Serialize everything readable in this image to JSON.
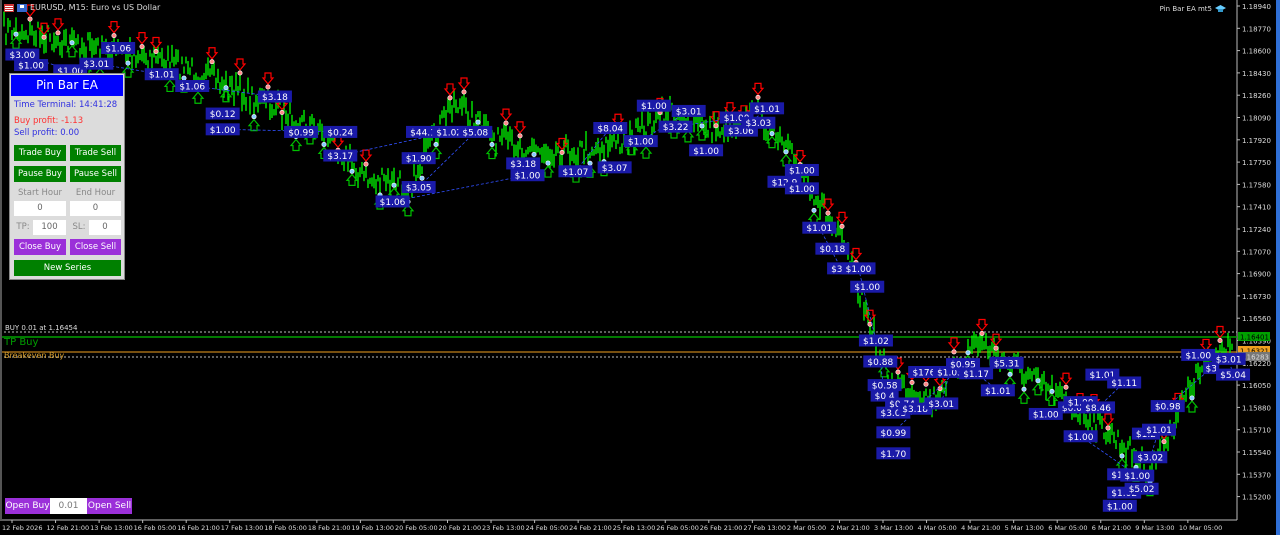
{
  "header": {
    "symbol_title": "EURUSD, M15:  Euro vs US Dollar",
    "ea_label": "Pin Bar EA mt5",
    "icons": [
      "menu-icon",
      "chart-type-icon",
      "hat-icon"
    ]
  },
  "panel": {
    "title": "Pin Bar EA",
    "time_terminal": "Time Terminal: 14:41:28",
    "buy_profit": "Buy profit: -1.13",
    "sell_profit": "Sell profit: 0.00",
    "trade_buy": "Trade Buy",
    "trade_sell": "Trade Sell",
    "pause_buy": "Pause Buy",
    "pause_sell": "Pause Sell",
    "start_hour_label": "Start Hour",
    "end_hour_label": "End Hour",
    "start_hour": "0",
    "end_hour": "0",
    "tp_label": "TP:",
    "tp_value": "100",
    "sl_label": "SL:",
    "sl_value": "0",
    "close_buy": "Close Buy",
    "close_sell": "Close Sell",
    "new_series": "New Series"
  },
  "bottom_bar": {
    "open_buy": "Open Buy",
    "lot": "0.01",
    "open_sell": "Open Sell"
  },
  "lines": {
    "buy_line_label": "BUY 0.01 at 1.16454",
    "tp_label": "TP Buy",
    "breakeven_label": "Breakeven Buy",
    "tp_price": "1.16401",
    "bid_price": "1.16321",
    "ask_price": "1.16283"
  },
  "colors": {
    "bull": "#00ff00",
    "bear_arrow": "#ff0000",
    "bull_arrow": "#00c000",
    "label_bg": "#1a1aa8",
    "tp": "#00a000",
    "bid": "#f0a020",
    "panel_title": "#0000ff"
  },
  "chart_data": {
    "type": "candlestick",
    "symbol": "EURUSD",
    "timeframe": "M15",
    "y_ticks": [
      "1.18940",
      "1.18770",
      "1.18600",
      "1.18430",
      "1.18260",
      "1.18090",
      "1.17920",
      "1.17750",
      "1.17580",
      "1.17410",
      "1.17240",
      "1.17070",
      "1.16900",
      "1.16730",
      "1.16560",
      "1.16390",
      "1.16220",
      "1.16050",
      "1.15880",
      "1.15710",
      "1.15540",
      "1.15370",
      "1.15200"
    ],
    "ylim": [
      1.151,
      1.1897
    ],
    "x_ticks": [
      "12 Feb 2026",
      "12 Feb 21:00",
      "13 Feb 13:00",
      "16 Feb 05:00",
      "16 Feb 21:00",
      "17 Feb 13:00",
      "18 Feb 05:00",
      "18 Feb 21:00",
      "19 Feb 13:00",
      "20 Feb 05:00",
      "20 Feb 21:00",
      "23 Feb 13:00",
      "24 Feb 05:00",
      "24 Feb 21:00",
      "25 Feb 13:00",
      "26 Feb 05:00",
      "26 Feb 21:00",
      "27 Feb 13:00",
      "2 Mar 05:00",
      "2 Mar 21:00",
      "3 Mar 13:00",
      "4 Mar 05:00",
      "4 Mar 21:00",
      "5 Mar 13:00",
      "6 Mar 05:00",
      "6 Mar 21:00",
      "9 Mar 13:00",
      "10 Mar 05:00"
    ],
    "price_at_ticks": [
      1.18757,
      1.18681,
      1.18605,
      1.18566,
      1.18452,
      1.183,
      1.18147,
      1.17995,
      1.17614,
      1.17576,
      1.18223,
      1.17919,
      1.17842,
      1.17842,
      1.17919,
      1.18147,
      1.17995,
      1.18109,
      1.1769,
      1.1708,
      1.16089,
      1.15937,
      1.16394,
      1.16165,
      1.15937,
      1.15708,
      1.15403,
      1.16089,
      1.1647
    ],
    "annotations": [
      {
        "text": "$3.00",
        "t": 0.1,
        "price": 1.1857
      },
      {
        "text": "$1.00",
        "t": 0.3,
        "price": 1.1849
      },
      {
        "text": "$1.00",
        "t": 1.2,
        "price": 1.1845
      },
      {
        "text": "$3.01",
        "t": 1.8,
        "price": 1.185
      },
      {
        "text": "$1.06",
        "t": 2.3,
        "price": 1.1862
      },
      {
        "text": "$1.01",
        "t": 3.3,
        "price": 1.1842
      },
      {
        "text": "$1.06",
        "t": 4.0,
        "price": 1.1833
      },
      {
        "text": "$0.12",
        "t": 4.7,
        "price": 1.1812
      },
      {
        "text": "$3.18",
        "t": 5.9,
        "price": 1.1825
      },
      {
        "text": "$1.00",
        "t": 4.7,
        "price": 1.18
      },
      {
        "text": "$0.99",
        "t": 6.5,
        "price": 1.1798
      },
      {
        "text": "$0.24",
        "t": 7.4,
        "price": 1.1798
      },
      {
        "text": "$3.17",
        "t": 7.4,
        "price": 1.178
      },
      {
        "text": "$44.1",
        "t": 9.3,
        "price": 1.1798
      },
      {
        "text": "$1.02",
        "t": 9.9,
        "price": 1.1798
      },
      {
        "text": "$5.08",
        "t": 10.5,
        "price": 1.1798
      },
      {
        "text": "$1.90",
        "t": 9.2,
        "price": 1.1778
      },
      {
        "text": "$3.05",
        "t": 9.2,
        "price": 1.1756
      },
      {
        "text": "$1.06",
        "t": 8.6,
        "price": 1.1745
      },
      {
        "text": "$3.18",
        "t": 11.6,
        "price": 1.1774
      },
      {
        "text": "$1.00",
        "t": 11.7,
        "price": 1.1765
      },
      {
        "text": "$1.07",
        "t": 12.8,
        "price": 1.1768
      },
      {
        "text": "$3.07",
        "t": 13.7,
        "price": 1.1771
      },
      {
        "text": "$8.04",
        "t": 13.6,
        "price": 1.1801
      },
      {
        "text": "$1.00",
        "t": 14.3,
        "price": 1.1791
      },
      {
        "text": "$1.00",
        "t": 14.6,
        "price": 1.1818
      },
      {
        "text": "$3.01",
        "t": 15.4,
        "price": 1.1814
      },
      {
        "text": "$3.22",
        "t": 15.1,
        "price": 1.1802
      },
      {
        "text": "$1.00",
        "t": 15.8,
        "price": 1.1784
      },
      {
        "text": "$1.00",
        "t": 16.5,
        "price": 1.1809
      },
      {
        "text": "$3.06",
        "t": 16.6,
        "price": 1.1799
      },
      {
        "text": "$3.03",
        "t": 17.0,
        "price": 1.1805
      },
      {
        "text": "$1.01",
        "t": 17.2,
        "price": 1.1816
      },
      {
        "text": "$12.9",
        "t": 17.6,
        "price": 1.176
      },
      {
        "text": "$1.00",
        "t": 18.0,
        "price": 1.1769
      },
      {
        "text": "$1.00",
        "t": 18.0,
        "price": 1.1755
      },
      {
        "text": "$1.01",
        "t": 18.4,
        "price": 1.1725
      },
      {
        "text": "$0.18",
        "t": 18.7,
        "price": 1.1709
      },
      {
        "text": "$3.0",
        "t": 18.9,
        "price": 1.1694
      },
      {
        "text": "$1.00",
        "t": 19.3,
        "price": 1.1694
      },
      {
        "text": "$1.00",
        "t": 19.5,
        "price": 1.168
      },
      {
        "text": "$1.02",
        "t": 19.7,
        "price": 1.1639
      },
      {
        "text": "$0.88",
        "t": 19.8,
        "price": 1.1623
      },
      {
        "text": "$0.58",
        "t": 19.9,
        "price": 1.1605
      },
      {
        "text": "$0.4",
        "t": 19.9,
        "price": 1.1597
      },
      {
        "text": "$3.03",
        "t": 20.1,
        "price": 1.1584
      },
      {
        "text": "$0.74",
        "t": 20.3,
        "price": 1.1591
      },
      {
        "text": "$3.18",
        "t": 20.6,
        "price": 1.1587
      },
      {
        "text": "$3.01",
        "t": 21.2,
        "price": 1.1591
      },
      {
        "text": "$176.6",
        "t": 20.9,
        "price": 1.1615
      },
      {
        "text": "$1.03",
        "t": 21.4,
        "price": 1.1615
      },
      {
        "text": "$0.99",
        "t": 20.1,
        "price": 1.1569
      },
      {
        "text": "$1.70",
        "t": 20.1,
        "price": 1.1553
      },
      {
        "text": "$0.95",
        "t": 21.7,
        "price": 1.1621
      },
      {
        "text": "$1.17",
        "t": 22.0,
        "price": 1.1614
      },
      {
        "text": "$5.31",
        "t": 22.7,
        "price": 1.1622
      },
      {
        "text": "$1.01",
        "t": 22.5,
        "price": 1.1601
      },
      {
        "text": "$1.00",
        "t": 23.6,
        "price": 1.1583
      },
      {
        "text": "$0.0",
        "t": 24.2,
        "price": 1.1588
      },
      {
        "text": "$1.00",
        "t": 24.4,
        "price": 1.1592
      },
      {
        "text": "$8.46",
        "t": 24.8,
        "price": 1.1588
      },
      {
        "text": "$1.01",
        "t": 24.9,
        "price": 1.1613
      },
      {
        "text": "$1.11",
        "t": 25.4,
        "price": 1.1607
      },
      {
        "text": "$1.00",
        "t": 24.4,
        "price": 1.1566
      },
      {
        "text": "$17.6",
        "t": 25.4,
        "price": 1.1537
      },
      {
        "text": "$1.00",
        "t": 25.7,
        "price": 1.1536
      },
      {
        "text": "$1.02",
        "t": 25.4,
        "price": 1.1523
      },
      {
        "text": "$1.00",
        "t": 25.3,
        "price": 1.1513
      },
      {
        "text": "$5.02",
        "t": 25.8,
        "price": 1.1526
      },
      {
        "text": "$3.02",
        "t": 26.0,
        "price": 1.155
      },
      {
        "text": "$1.2",
        "t": 25.9,
        "price": 1.1568
      },
      {
        "text": "$1.01",
        "t": 26.2,
        "price": 1.1571
      },
      {
        "text": "$0.98",
        "t": 26.4,
        "price": 1.1589
      },
      {
        "text": "$1.00",
        "t": 27.1,
        "price": 1.1628
      },
      {
        "text": "$3",
        "t": 27.4,
        "price": 1.1618
      },
      {
        "text": "$5.04",
        "t": 27.9,
        "price": 1.1613
      },
      {
        "text": "$3.01",
        "t": 27.8,
        "price": 1.1625
      }
    ]
  }
}
